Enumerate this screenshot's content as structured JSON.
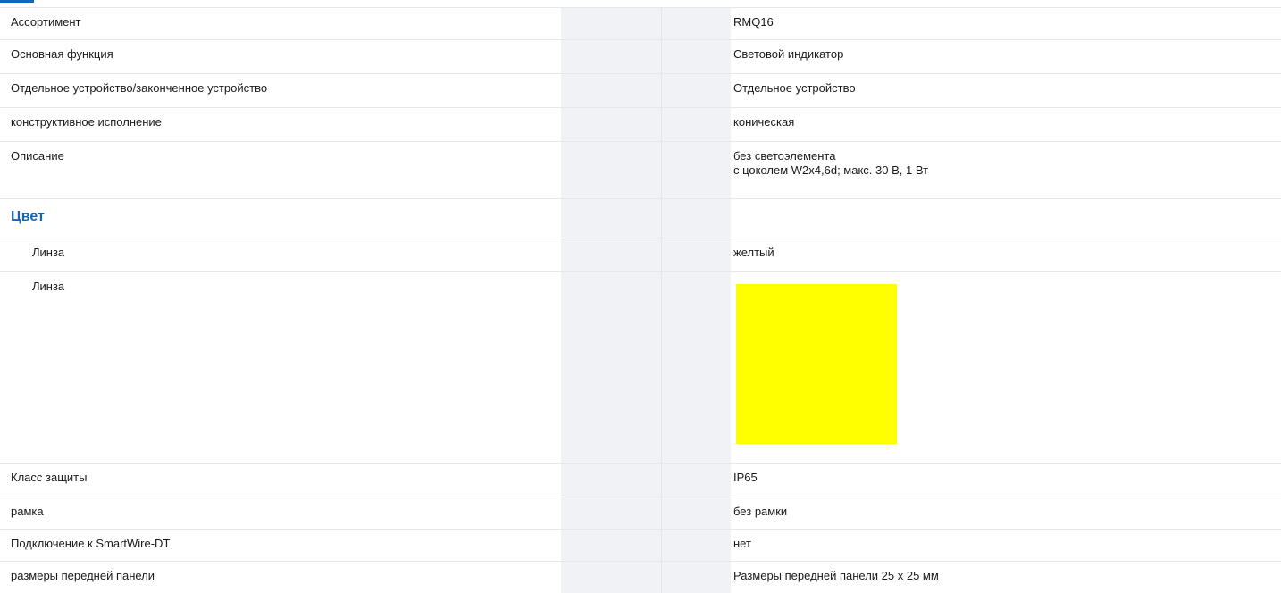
{
  "rows": [
    {
      "label": "Ассортимент",
      "value": "RMQ16"
    },
    {
      "label": "Основная функция",
      "value": "Световой индикатор"
    },
    {
      "label": "Отдельное устройство/законченное устройство",
      "value": "Отдельное устройство"
    },
    {
      "label": "конструктивное исполнение",
      "value": "коническая"
    },
    {
      "label": "Описание",
      "value_lines": [
        "без светоэлемента",
        "с цоколем W2x4,6d; макс. 30 В, 1 Вт"
      ]
    }
  ],
  "color_section": {
    "title": "Цвет",
    "lens_text_row": {
      "label": "Линза",
      "value": "желтый"
    },
    "lens_swatch_row": {
      "label": "Линза",
      "swatch_color": "#ffff00"
    }
  },
  "rows_after": [
    {
      "label": "Класс защиты",
      "value": "IP65"
    },
    {
      "label": "рамка",
      "value": "без рамки"
    },
    {
      "label": "Подключение к SmartWire-DT",
      "value": "нет"
    },
    {
      "label": "размеры передней панели",
      "value": "Размеры передней панели 25 x 25 мм"
    }
  ],
  "colors": {
    "accent": "#1465b7",
    "band": "#f1f2f5",
    "row_border": "#e6e8ec"
  }
}
